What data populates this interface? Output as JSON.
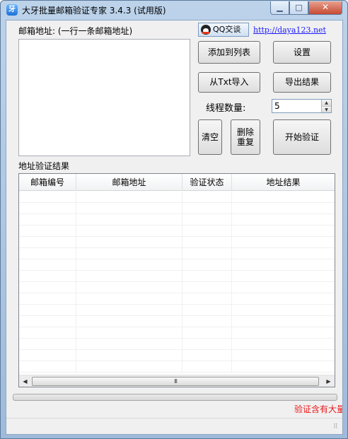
{
  "window": {
    "title": "大牙批量邮箱验证专家 3.4.3 (试用版)",
    "minimize_glyph": "▁",
    "maximize_glyph": "□",
    "close_glyph": "✕"
  },
  "input": {
    "label": "邮箱地址: (一行一条邮箱地址)",
    "value": ""
  },
  "header_links": {
    "qq_label": "QQ交谈",
    "url": "http://daya123.net"
  },
  "buttons": {
    "add_to_list": "添加到列表",
    "settings": "设置",
    "import_txt": "从Txt导入",
    "export_results": "导出结果",
    "clear": "清空",
    "remove_dup_line1": "删除",
    "remove_dup_line2": "重复",
    "start": "开始验证"
  },
  "threads": {
    "label": "线程数量:",
    "value": "5"
  },
  "results": {
    "section_label": "地址验证结果",
    "columns": [
      "邮箱编号",
      "邮箱地址",
      "验证状态",
      "地址结果"
    ],
    "rows": [],
    "scroll_grip": "III"
  },
  "progress": {
    "value": 0.0
  },
  "status": {
    "message": "验证含有大量"
  },
  "colors": {
    "status_text": "#e8191b",
    "link": "#1a1aff",
    "close_button": "#c74a33"
  },
  "icons": [
    "app-icon",
    "qq-icon",
    "spin-up-icon",
    "spin-down-icon",
    "scroll-left-icon",
    "scroll-right-icon",
    "resize-grip-icon"
  ]
}
